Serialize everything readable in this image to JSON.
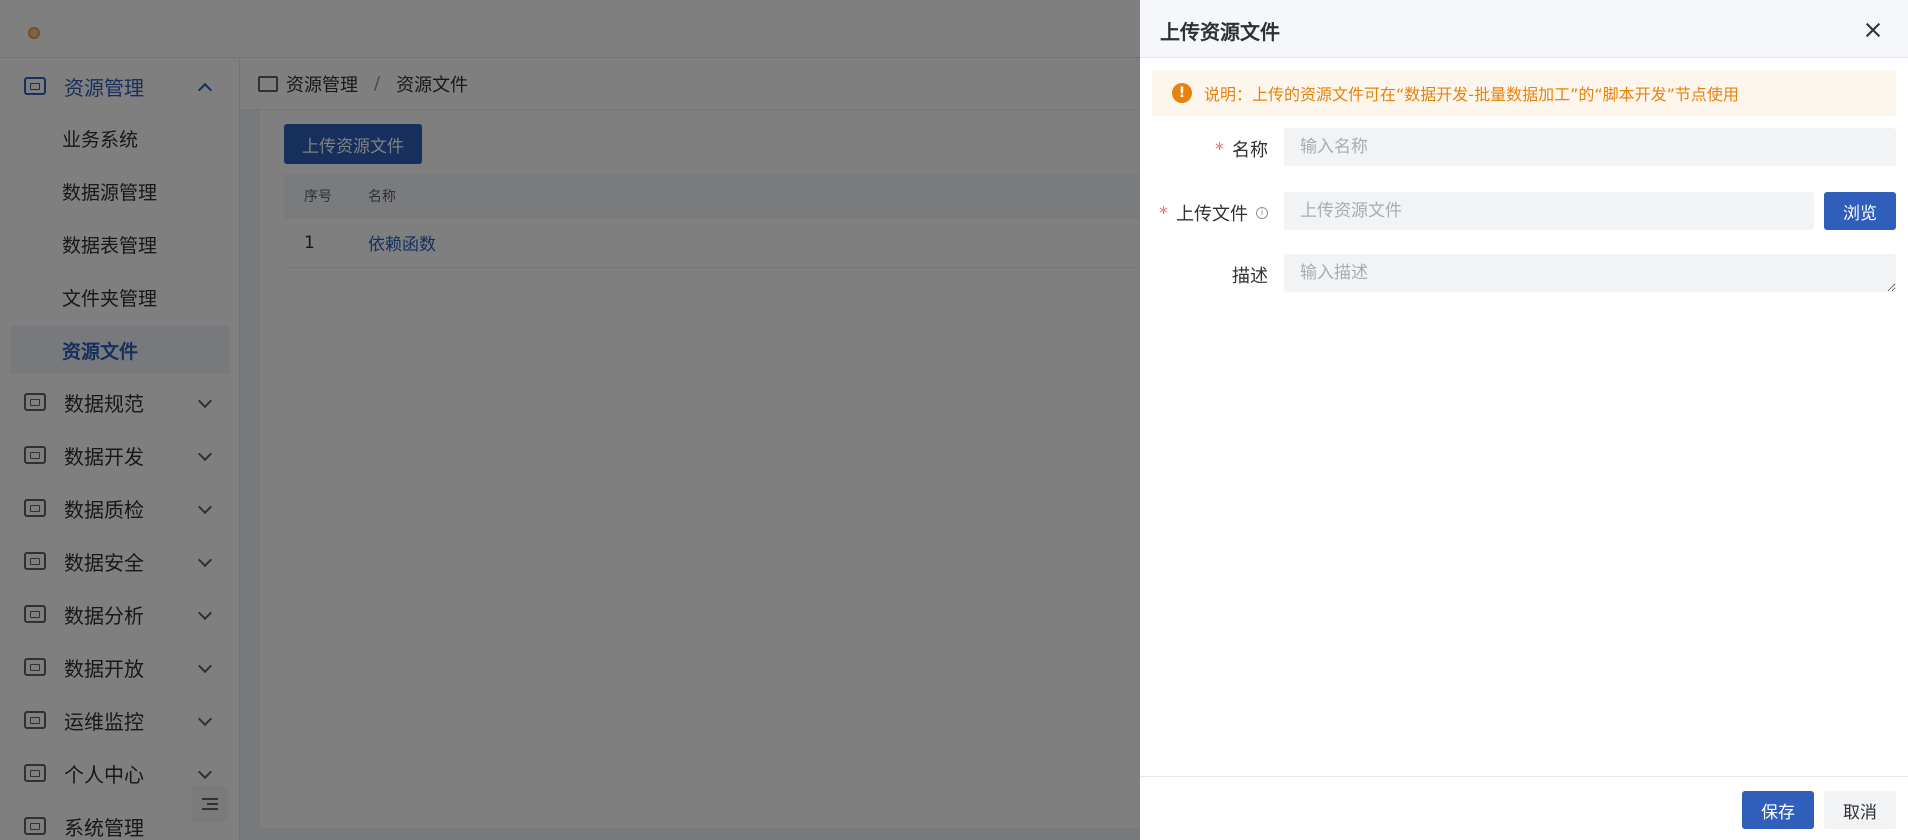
{
  "sidebar": {
    "menu": [
      {
        "label": "资源管理",
        "icon": "monitor-icon",
        "expanded": true
      },
      {
        "label": "数据规范",
        "icon": "monitor-icon",
        "expanded": false
      },
      {
        "label": "数据开发",
        "icon": "code-icon",
        "expanded": false
      },
      {
        "label": "数据质检",
        "icon": "document-icon",
        "expanded": false
      },
      {
        "label": "数据安全",
        "icon": "shield-check-icon",
        "expanded": false
      },
      {
        "label": "数据分析",
        "icon": "analysis-icon",
        "expanded": false
      },
      {
        "label": "数据开放",
        "icon": "share-icon",
        "expanded": false
      },
      {
        "label": "运维监控",
        "icon": "chart-line-icon",
        "expanded": false
      },
      {
        "label": "个人中心",
        "icon": "user-icon",
        "expanded": false
      },
      {
        "label": "系统管理",
        "icon": "settings-icon",
        "expanded": false
      }
    ],
    "submenu": [
      {
        "label": "业务系统"
      },
      {
        "label": "数据源管理"
      },
      {
        "label": "数据表管理"
      },
      {
        "label": "文件夹管理"
      },
      {
        "label": "资源文件",
        "active": true
      }
    ],
    "collapse_icon": "collapse-menu-icon"
  },
  "breadcrumb": {
    "items": [
      "资源管理",
      "资源文件"
    ],
    "separator": "/"
  },
  "main": {
    "upload_button": "上传资源文件",
    "table": {
      "columns": [
        "序号",
        "名称"
      ],
      "rows": [
        {
          "index": "1",
          "name": "依赖函数"
        }
      ]
    }
  },
  "drawer": {
    "title": "上传资源文件",
    "notice": "说明：上传的资源文件可在“数据开发-批量数据加工”的“脚本开发”节点使用",
    "fields": {
      "name": {
        "label": "名称",
        "placeholder": "输入名称",
        "value": "",
        "required": true
      },
      "file": {
        "label": "上传文件",
        "placeholder": "上传资源文件",
        "value": "",
        "required": true,
        "browse": "浏览"
      },
      "description": {
        "label": "描述",
        "placeholder": "输入描述",
        "value": ""
      }
    },
    "footer": {
      "save": "保存",
      "cancel": "取消"
    }
  },
  "colors": {
    "primary": "#2f5fba",
    "warning": "#e6820e",
    "warning_bg": "#fdf6ec",
    "required": "#f56c6c"
  }
}
